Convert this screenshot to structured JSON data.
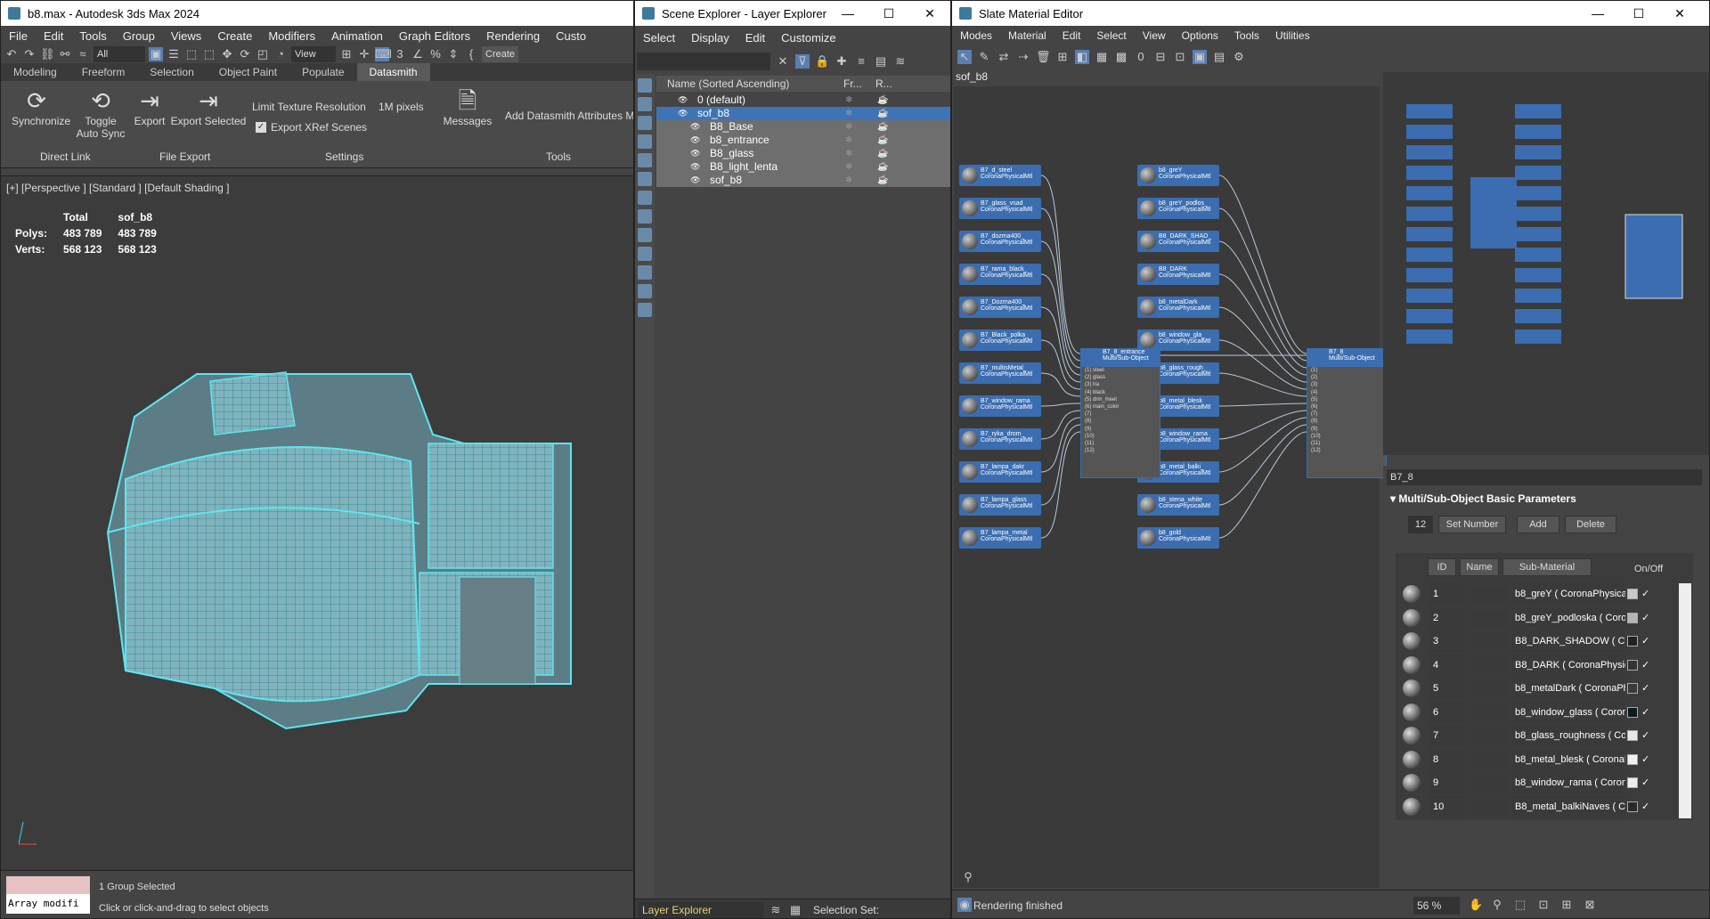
{
  "max": {
    "title": "b8.max - Autodesk 3ds Max 2024",
    "menu": [
      "File",
      "Edit",
      "Tools",
      "Group",
      "Views",
      "Create",
      "Modifiers",
      "Animation",
      "Graph Editors",
      "Rendering",
      "Custo"
    ],
    "toolbar_filter": "All",
    "toolbar_view": "View",
    "toolbar_create": "Create",
    "ribbon_tabs": [
      "Modeling",
      "Freeform",
      "Selection",
      "Object Paint",
      "Populate",
      "Datasmith"
    ],
    "ribbon": {
      "sync": "Synchronize",
      "toggle": "Toggle",
      "autosync": "Auto Sync",
      "export": "Export",
      "export_selected": "Export Selected",
      "limit_texture": "Limit Texture Resolution",
      "pixels": "1M pixels",
      "export_xref": "Export XRef Scenes",
      "messages": "Messages",
      "add_attr": "Add Datasmith Attributes M",
      "grp_direct": "Direct Link",
      "grp_file": "File Export",
      "grp_settings": "Settings",
      "grp_tools": "Tools"
    },
    "viewport_label": "[+] [Perspective ] [Standard ] [Default Shading ]",
    "stats": {
      "h_total": "Total",
      "h_obj": "sof_b8",
      "polys_l": "Polys:",
      "polys_t": "483 789",
      "polys_o": "483 789",
      "verts_l": "Verts:",
      "verts_t": "568 123",
      "verts_o": "568 123"
    },
    "status": {
      "selected": "1 Group Selected",
      "hint": "Click or click-and-drag to select objects",
      "script": "Array modifi"
    }
  },
  "scene": {
    "title": "Scene Explorer - Layer Explorer",
    "menu": [
      "Select",
      "Display",
      "Edit",
      "Customize"
    ],
    "header": "Name (Sorted Ascending)",
    "col_fr": "Fr...",
    "col_r": "R...",
    "layers": [
      {
        "name": "0 (default)"
      },
      {
        "name": "sof_b8"
      },
      {
        "name": "B8_Base"
      },
      {
        "name": "b8_entrance"
      },
      {
        "name": "B8_glass"
      },
      {
        "name": "B8_light_lenta"
      },
      {
        "name": "sof_b8"
      }
    ],
    "footer": "Layer Explorer",
    "selection_set": "Selection Set:"
  },
  "slate": {
    "title": "Slate Material Editor",
    "menu": [
      "Modes",
      "Material",
      "Edit",
      "Select",
      "View",
      "Options",
      "Tools",
      "Utilities"
    ],
    "view_tab": "sof_b8",
    "material_name": "B7_8",
    "rollout": "Multi/Sub-Object Basic Parameters",
    "set_number_val": "12",
    "set_number": "Set Number",
    "add": "Add",
    "delete": "Delete",
    "col_id": "ID",
    "col_name": "Name",
    "col_sub": "Sub-Material",
    "col_onoff": "On/Off",
    "materials": [
      {
        "id": "1",
        "sub": "b8_greY  ( CoronaPhysical",
        "color": "#c9c9c9"
      },
      {
        "id": "2",
        "sub": "b8_greY_podloska  ( Coron",
        "color": "#b5b5b5"
      },
      {
        "id": "3",
        "sub": "B8_DARK_SHADOW  ( Cor",
        "color": "#222222"
      },
      {
        "id": "4",
        "sub": "B8_DARK  ( CoronaPhysica",
        "color": "#333333"
      },
      {
        "id": "5",
        "sub": "b8_metalDark  ( CoronaPh",
        "color": "#3a3a3a"
      },
      {
        "id": "6",
        "sub": "b8_window_glass  ( Coron",
        "color": "#0d1a1f"
      },
      {
        "id": "7",
        "sub": "b8_glass_roughness  ( Cor",
        "color": "#e8e8e8"
      },
      {
        "id": "8",
        "sub": "b8_metal_blesk  ( CoronaF",
        "color": "#f0f0f0"
      },
      {
        "id": "9",
        "sub": "b8_window_rama  ( Coron",
        "color": "#eeeeee"
      },
      {
        "id": "10",
        "sub": "B8_metal_balkiNaves  ( Co",
        "color": "#2a2a2a"
      }
    ],
    "status": "Rendering finished",
    "zoom": "56 %",
    "nodes_left": [
      "B7_d_steel",
      "B7_glass_vsad",
      "B7_dozma400_",
      "B7_rama_black_",
      "B7_Dozma400_",
      "B7_Black_polka_",
      "B7_multisMetal_",
      "B7_window_rama",
      "B7_ryka_drom_",
      "B7_lampa_dakr",
      "B7_lampa_glass",
      "B7_lampa_metal"
    ],
    "nodes_right": [
      "b8_greY",
      "b8_greY_podlos_",
      "B8_DARK_SHAD_",
      "B8_DARK",
      "b8_metalDark",
      "b8_window_gla_",
      "b8_glass_rough_",
      "b8_metal_blesk",
      "b8_window_rama",
      "b8_metal_balki_",
      "b8_stena_white",
      "b8_gold"
    ],
    "node_sub": "CoronaPhysicalMtl",
    "mid_node": "B7_8_entrance",
    "mid_sub": "Multi/Sub-Object",
    "out_node": "B7_8",
    "out_sub": "Multi/Sub-Object",
    "mid_slots": [
      "(1) steel",
      "(2) glass",
      "(3) tra",
      "(4) black",
      "(5) drm_meet",
      "(6) main_color",
      "(7)",
      "(8)",
      "(9)",
      "(10)",
      "(11)",
      "(12)"
    ],
    "out_slots": [
      "(1)",
      "(2)",
      "(3)",
      "(4)",
      "(5)",
      "(6)",
      "(7)",
      "(8)",
      "(9)",
      "(10)",
      "(11)",
      "(12)"
    ]
  },
  "colors": {
    "accent": "#3b6db0",
    "wire": "#5ee6f0",
    "selection": "#6e6e6e"
  }
}
